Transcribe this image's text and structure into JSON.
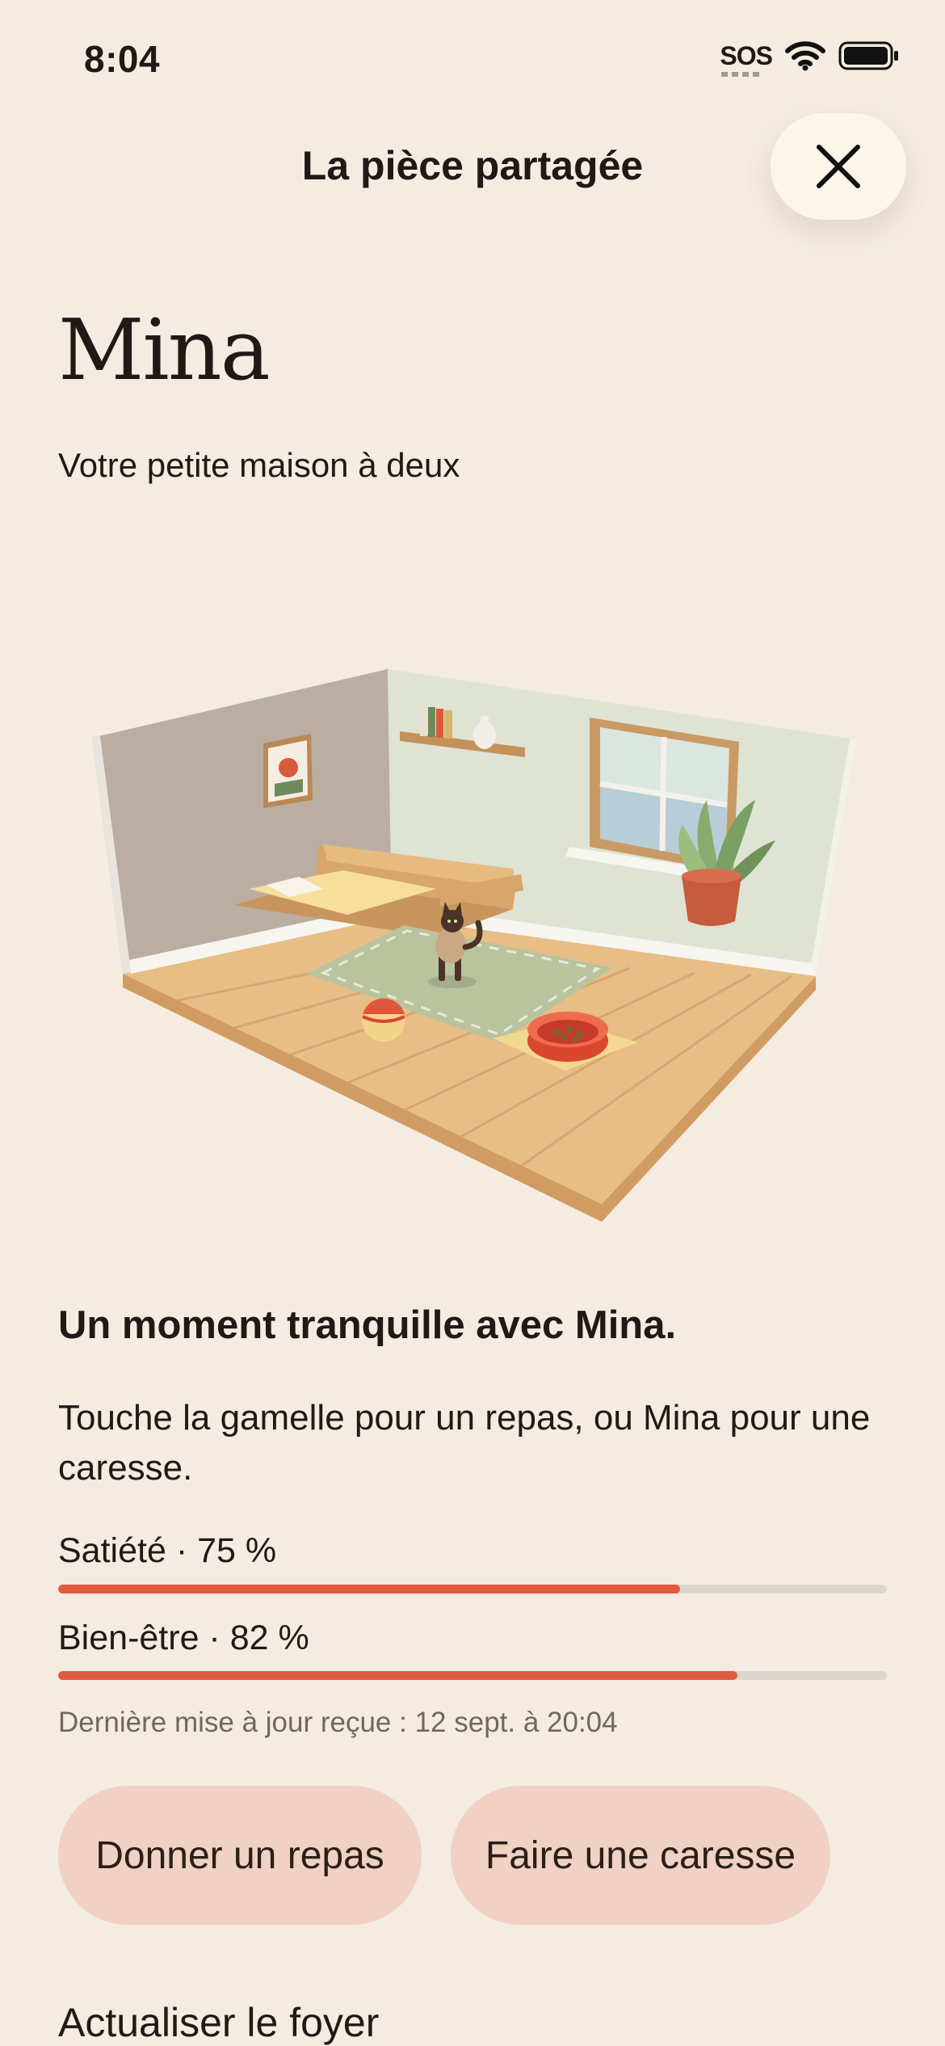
{
  "status_bar": {
    "time": "8:04",
    "sos": "SOS"
  },
  "header": {
    "title": "La pièce partagée",
    "close_icon": "close-icon"
  },
  "pet": {
    "name": "Mina",
    "subtitle": "Votre petite maison à deux"
  },
  "room": {
    "description_icon": "isometric-room-illustration"
  },
  "message": {
    "headline": "Un moment tranquille avec Mina.",
    "hint": "Touche la gamelle pour un repas, ou Mina pour une caresse."
  },
  "stats": [
    {
      "label": "Satiété · 75 %",
      "value": 0.75
    },
    {
      "label": "Bien-être · 82 %",
      "value": 0.82
    }
  ],
  "last_update": "Dernière mise à jour reçue : 12 sept. à 20:04",
  "actions": {
    "feed": "Donner un repas",
    "pet": "Faire une caresse",
    "refresh": "Actualiser le foyer"
  },
  "colors": {
    "background": "#f4ece1",
    "accent": "#e05a3e",
    "button": "#f0d1c3",
    "track": "#dcd6cc"
  }
}
